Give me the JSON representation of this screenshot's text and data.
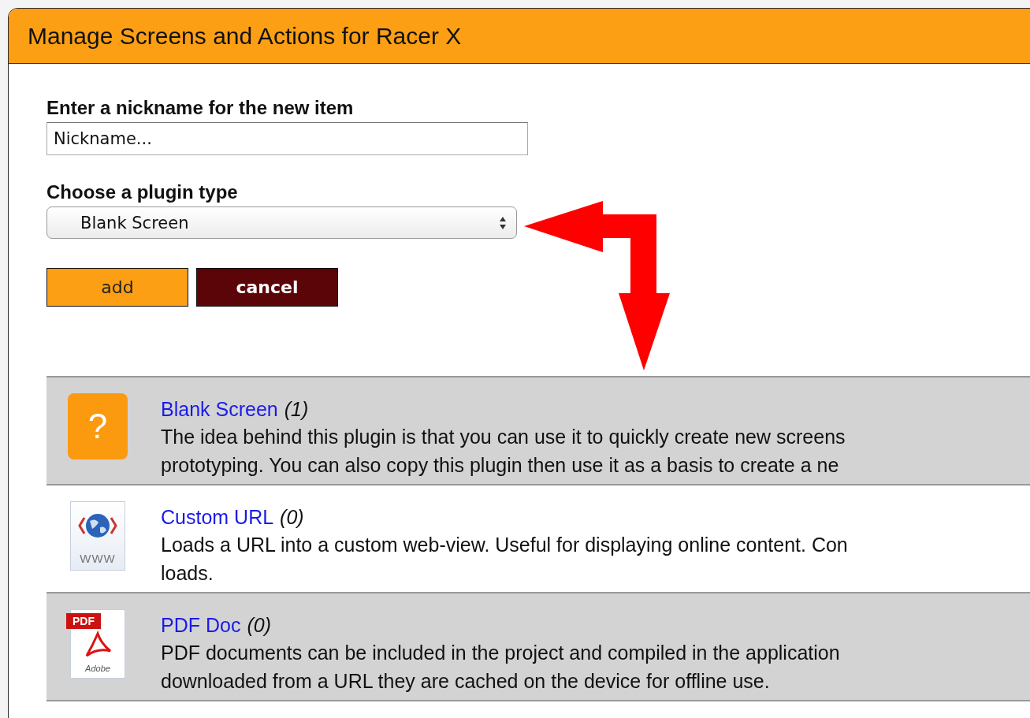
{
  "window": {
    "title": "Manage Screens and Actions for Racer X"
  },
  "nickname": {
    "label": "Enter a nickname for the new item",
    "placeholder": "Nickname..."
  },
  "plugin_type": {
    "label": "Choose a plugin type",
    "value": "Blank Screen"
  },
  "buttons": [
    {
      "kind": "primary",
      "label": "add"
    },
    {
      "kind": "secondary",
      "label": "cancel"
    }
  ],
  "plugins": [
    {
      "kind": "blank",
      "icon_text": "?",
      "name": "Blank Screen",
      "count": "(1)",
      "shaded": true,
      "description": [
        "The idea behind this plugin is that you can use it to quickly create new screens",
        "prototyping. You can also copy this plugin then use it as a basis to create a ne"
      ]
    },
    {
      "kind": "url",
      "icon_text": "WWW",
      "name": "Custom URL",
      "count": "(0)",
      "shaded": false,
      "description": [
        "Loads a URL into a custom web-view. Useful for displaying online content. Con",
        "loads."
      ]
    },
    {
      "kind": "pdf",
      "icon_text": "PDF",
      "icon_subtext": "Adobe",
      "name": "PDF Doc",
      "count": "(0)",
      "shaded": true,
      "description": [
        "PDF documents can be included in the project and compiled in the application",
        "downloaded from a URL they are cached on the device for offline use."
      ]
    }
  ]
}
